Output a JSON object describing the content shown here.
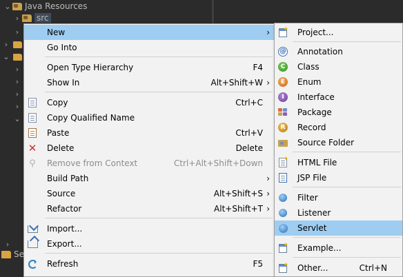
{
  "tree": {
    "project_label": "Java Resources",
    "src_label": "src",
    "bottom_label": "Se"
  },
  "main_menu": [
    {
      "label": "New",
      "shortcut": "",
      "submenu": true,
      "icon": "none",
      "highlighted": true
    },
    {
      "label": "Go Into",
      "shortcut": "",
      "submenu": false,
      "icon": "none"
    },
    {
      "label": "Open Type Hierarchy",
      "shortcut": "F4",
      "submenu": false,
      "icon": "none"
    },
    {
      "label": "Show In",
      "shortcut": "Alt+Shift+W",
      "submenu": true,
      "icon": "none"
    },
    {
      "label": "Copy",
      "shortcut": "Ctrl+C",
      "submenu": false,
      "icon": "copy-icon"
    },
    {
      "label": "Copy Qualified Name",
      "shortcut": "",
      "submenu": false,
      "icon": "copy-qualified-name-icon"
    },
    {
      "label": "Paste",
      "shortcut": "Ctrl+V",
      "submenu": false,
      "icon": "paste-icon"
    },
    {
      "label": "Delete",
      "shortcut": "Delete",
      "submenu": false,
      "icon": "delete-icon"
    },
    {
      "label": "Remove from Context",
      "shortcut": "Ctrl+Alt+Shift+Down",
      "submenu": false,
      "icon": "remove-context-icon",
      "disabled": true
    },
    {
      "label": "Build Path",
      "shortcut": "",
      "submenu": true,
      "icon": "none"
    },
    {
      "label": "Source",
      "shortcut": "Alt+Shift+S",
      "submenu": true,
      "icon": "none"
    },
    {
      "label": "Refactor",
      "shortcut": "Alt+Shift+T",
      "submenu": true,
      "icon": "none"
    },
    {
      "label": "Import...",
      "shortcut": "",
      "submenu": false,
      "icon": "import-icon"
    },
    {
      "label": "Export...",
      "shortcut": "",
      "submenu": false,
      "icon": "export-icon"
    },
    {
      "label": "Refresh",
      "shortcut": "F5",
      "submenu": false,
      "icon": "refresh-icon"
    }
  ],
  "new_submenu": [
    {
      "label": "Project...",
      "shortcut": "",
      "icon": "new-project-icon"
    },
    {
      "label": "Annotation",
      "shortcut": "",
      "icon": "annotation-icon"
    },
    {
      "label": "Class",
      "shortcut": "",
      "icon": "class-icon"
    },
    {
      "label": "Enum",
      "shortcut": "",
      "icon": "enum-icon"
    },
    {
      "label": "Interface",
      "shortcut": "",
      "icon": "interface-icon"
    },
    {
      "label": "Package",
      "shortcut": "",
      "icon": "package-icon"
    },
    {
      "label": "Record",
      "shortcut": "",
      "icon": "record-icon"
    },
    {
      "label": "Source Folder",
      "shortcut": "",
      "icon": "source-folder-icon"
    },
    {
      "label": "HTML File",
      "shortcut": "",
      "icon": "html-file-icon"
    },
    {
      "label": "JSP File",
      "shortcut": "",
      "icon": "jsp-file-icon"
    },
    {
      "label": "Filter",
      "shortcut": "",
      "icon": "filter-icon"
    },
    {
      "label": "Listener",
      "shortcut": "",
      "icon": "listener-icon"
    },
    {
      "label": "Servlet",
      "shortcut": "",
      "icon": "servlet-icon",
      "highlighted": true
    },
    {
      "label": "Example...",
      "shortcut": "",
      "icon": "example-icon"
    },
    {
      "label": "Other...",
      "shortcut": "Ctrl+N",
      "icon": "other-icon"
    }
  ],
  "submenu_arrow": "›",
  "colors": {
    "ide_background": "#2b2b2b",
    "menu_background": "#f2f2f2",
    "highlight": "#9ecdf1",
    "disabled_text": "#8d8d8d"
  }
}
